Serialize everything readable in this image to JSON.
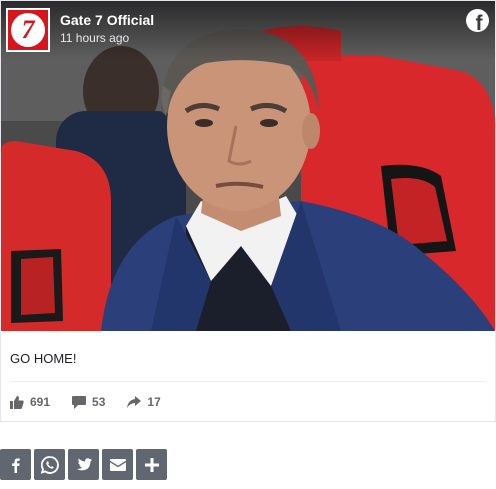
{
  "post": {
    "page_name": "Gate 7 Official",
    "timestamp": "11 hours ago",
    "caption": "GO HOME!",
    "avatar_glyph": "7",
    "likes": "691",
    "comments": "53",
    "shares": "17"
  },
  "icons": {
    "facebook": "facebook-icon",
    "like": "thumbs-up-icon",
    "comment": "comment-icon",
    "share": "share-arrow-icon"
  },
  "share_buttons": [
    {
      "name": "facebook",
      "icon": "facebook-icon"
    },
    {
      "name": "whatsapp",
      "icon": "whatsapp-icon"
    },
    {
      "name": "twitter",
      "icon": "twitter-icon"
    },
    {
      "name": "email",
      "icon": "envelope-icon"
    },
    {
      "name": "more",
      "icon": "plus-icon"
    }
  ],
  "colors": {
    "brand_red": "#d6161c",
    "share_button_bg": "#606770",
    "stat_text": "#65676b"
  }
}
